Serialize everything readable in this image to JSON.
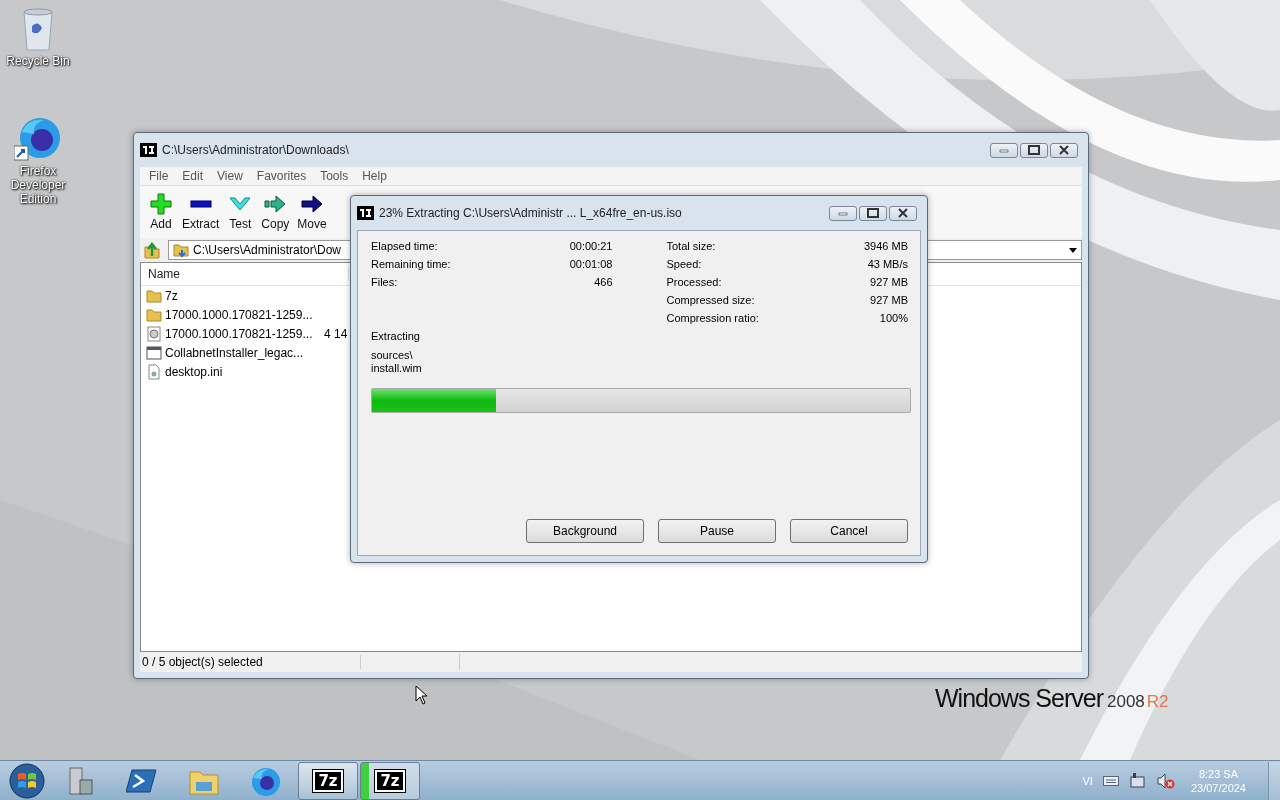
{
  "desktop_icons": [
    {
      "label": "Recycle Bin",
      "kind": "recycle"
    },
    {
      "label": "Firefox Developer Edition",
      "kind": "firefox"
    }
  ],
  "wallpaper_logo": {
    "name": "Windows Server",
    "version": "2008",
    "edition": "R2"
  },
  "main_window": {
    "title": "C:\\Users\\Administrator\\Downloads\\",
    "menu": [
      "File",
      "Edit",
      "View",
      "Favorites",
      "Tools",
      "Help"
    ],
    "toolbar": [
      {
        "label": "Add",
        "kind": "add"
      },
      {
        "label": "Extract",
        "kind": "extract"
      },
      {
        "label": "Test",
        "kind": "test"
      },
      {
        "label": "Copy",
        "kind": "copy"
      },
      {
        "label": "Move",
        "kind": "move"
      }
    ],
    "address": "C:\\Users\\Administrator\\Dow",
    "columns": [
      "Name"
    ],
    "rows": [
      {
        "name": "7z",
        "kind": "folder"
      },
      {
        "name": "17000.1000.170821-1259...",
        "kind": "folder"
      },
      {
        "name": "17000.1000.170821-1259...",
        "kind": "disc",
        "size": "4 14"
      },
      {
        "name": "CollabnetInstaller_legac...",
        "kind": "app"
      },
      {
        "name": "desktop.ini",
        "kind": "settings"
      }
    ],
    "status": "0 / 5 object(s) selected"
  },
  "dialog": {
    "title": "23% Extracting C:\\Users\\Administr ... L_x64fre_en-us.iso",
    "stats_left": [
      {
        "label": "Elapsed time:",
        "value": "00:00:21"
      },
      {
        "label": "Remaining time:",
        "value": "00:01:08"
      },
      {
        "label": "Files:",
        "value": "466"
      }
    ],
    "stats_right": [
      {
        "label": "Total size:",
        "value": "3946 MB"
      },
      {
        "label": "Speed:",
        "value": "43 MB/s"
      },
      {
        "label": "Processed:",
        "value": "927 MB"
      },
      {
        "label": "Compressed size:",
        "value": "927 MB"
      },
      {
        "label": "Compression ratio:",
        "value": "100%"
      }
    ],
    "operation": "Extracting",
    "path_lines": [
      "sources\\",
      "install.wim"
    ],
    "progress": {
      "level": 0.23
    },
    "buttons": [
      "Background",
      "Pause",
      "Cancel"
    ]
  },
  "taskbar": {
    "apps": [
      {
        "kind": "server"
      },
      {
        "kind": "powershell"
      },
      {
        "kind": "explorer"
      },
      {
        "kind": "firefox"
      },
      {
        "kind": "sevenzip",
        "label": "7z",
        "progress": false
      },
      {
        "kind": "sevenzip",
        "label": "7z",
        "progress": true
      }
    ],
    "language": "VI",
    "time": "8:23 SA",
    "date": "23/07/2024"
  }
}
